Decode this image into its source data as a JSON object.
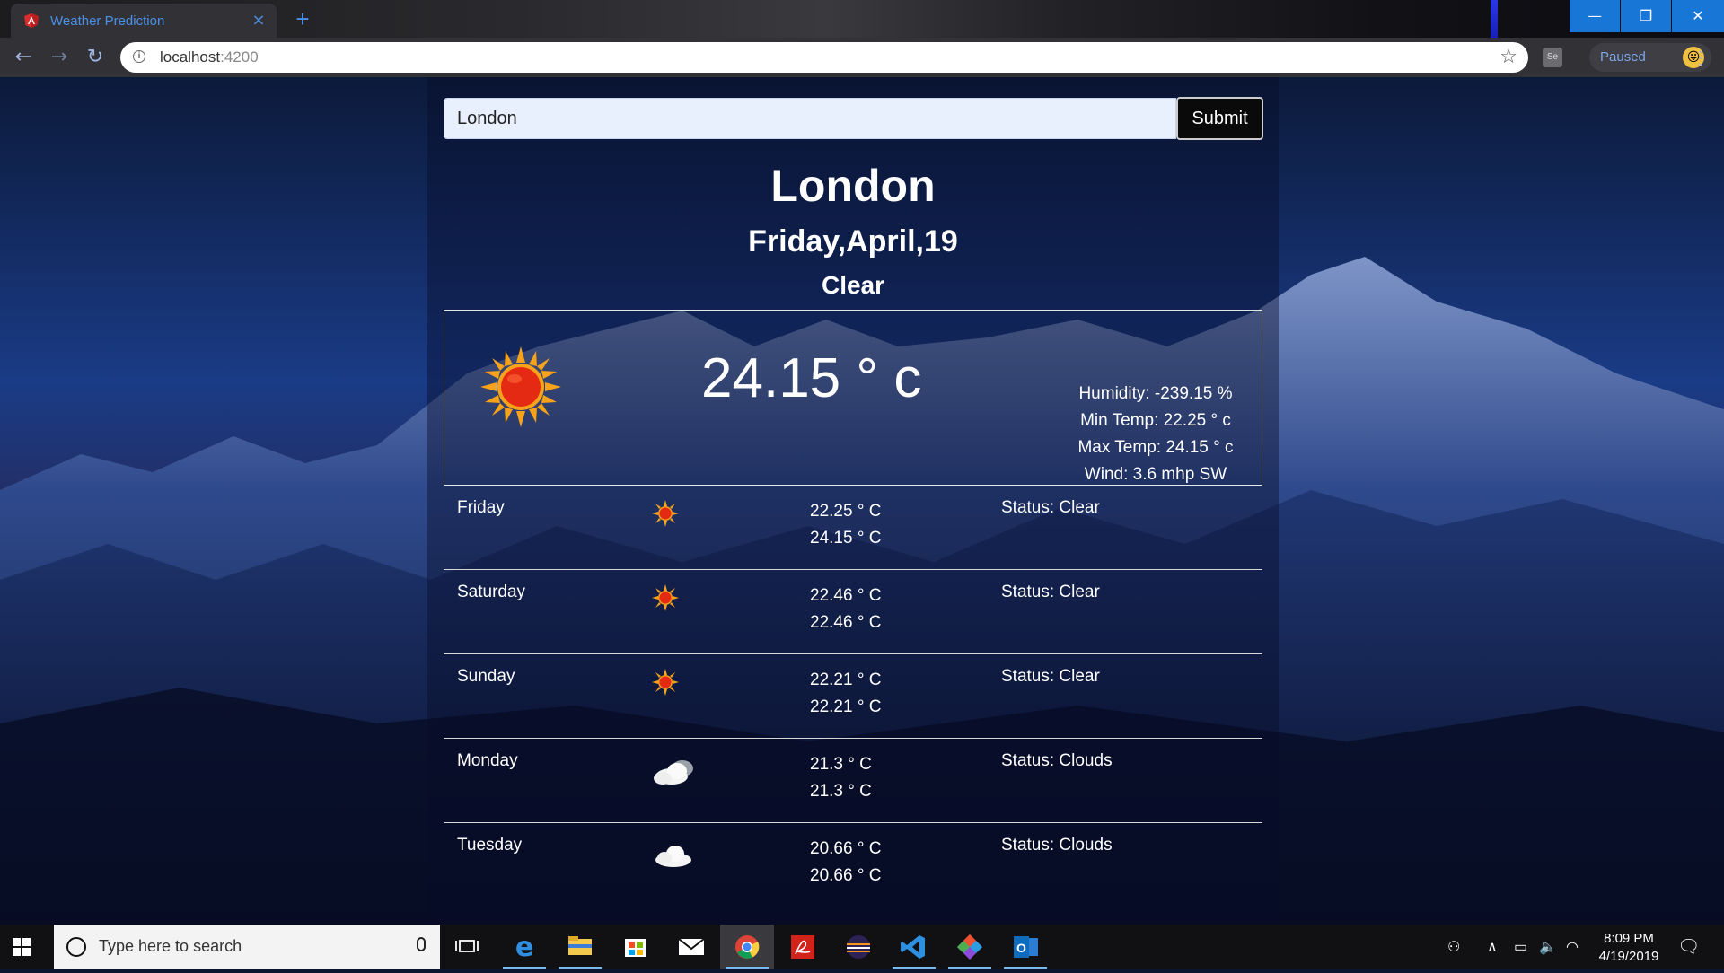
{
  "browser": {
    "tab_title": "Weather Prediction",
    "tab_close": "×",
    "new_tab": "+",
    "url_host": "localhost",
    "url_port": ":4200",
    "profile_status": "Paused",
    "extension_label": "Se",
    "window_controls": {
      "minimize": "—",
      "restore": "❐",
      "close": "✕"
    },
    "icons": [
      "angular-favicon",
      "back-icon",
      "forward-icon",
      "reload-icon",
      "info-icon",
      "star-icon",
      "menu-icon"
    ]
  },
  "app": {
    "search": {
      "value": "London",
      "submit_label": "Submit"
    },
    "city": "London",
    "date": "Friday,April,19",
    "condition": "Clear",
    "current": {
      "temperature": "24.15 ° c",
      "icon": "sun-icon",
      "humidity": "Humidity: -239.15 %",
      "min_temp": "Min Temp: 22.25 ° c",
      "max_temp": "Max Temp: 24.15 ° c",
      "wind": "Wind: 3.6 mhp SW"
    },
    "forecast": [
      {
        "day": "Friday",
        "icon": "sun-icon",
        "low": "22.25 ° C",
        "high": "24.15 ° C",
        "status": "Status: Clear"
      },
      {
        "day": "Saturday",
        "icon": "sun-icon",
        "low": "22.46 ° C",
        "high": "22.46 ° C",
        "status": "Status: Clear"
      },
      {
        "day": "Sunday",
        "icon": "sun-icon",
        "low": "22.21 ° C",
        "high": "22.21 ° C",
        "status": "Status: Clear"
      },
      {
        "day": "Monday",
        "icon": "partly-cloudy-icon",
        "low": "21.3 ° C",
        "high": "21.3 ° C",
        "status": "Status: Clouds"
      },
      {
        "day": "Tuesday",
        "icon": "cloud-icon",
        "low": "20.66 ° C",
        "high": "20.66 ° C",
        "status": "Status: Clouds"
      }
    ]
  },
  "taskbar": {
    "search_placeholder": "Type here to search",
    "apps": [
      "task-view",
      "edge",
      "file-explorer",
      "store",
      "mail",
      "chrome",
      "acrobat",
      "eclipse",
      "vscode",
      "git",
      "outlook"
    ],
    "time": "8:09 PM",
    "date": "4/19/2019"
  },
  "colors": {
    "accent_blue": "#1776d6",
    "tab_text": "#4a8fe8",
    "sun_red": "#e42a12",
    "sun_orange": "#f7a21b"
  }
}
